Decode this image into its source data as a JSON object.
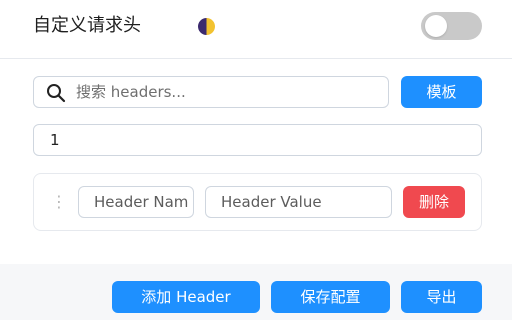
{
  "header": {
    "title": "自定义请求头",
    "toggle_enabled": false
  },
  "search": {
    "placeholder": "搜索 headers...",
    "value": ""
  },
  "toolbar": {
    "template_label": "模板"
  },
  "profile": {
    "value": "1"
  },
  "headers_list": [
    {
      "name_placeholder": "Header Name",
      "value_placeholder": "Header Value",
      "name": "",
      "value": "",
      "delete_label": "删除"
    }
  ],
  "footer": {
    "add_header_label": "添加 Header",
    "save_label": "保存配置",
    "export_label": "导出"
  },
  "colors": {
    "primary": "#1e90ff",
    "danger": "#f0494f",
    "toggle_off": "#c9c9c9",
    "border": "#cfd6df",
    "footer_bg": "#f6f7f9"
  }
}
